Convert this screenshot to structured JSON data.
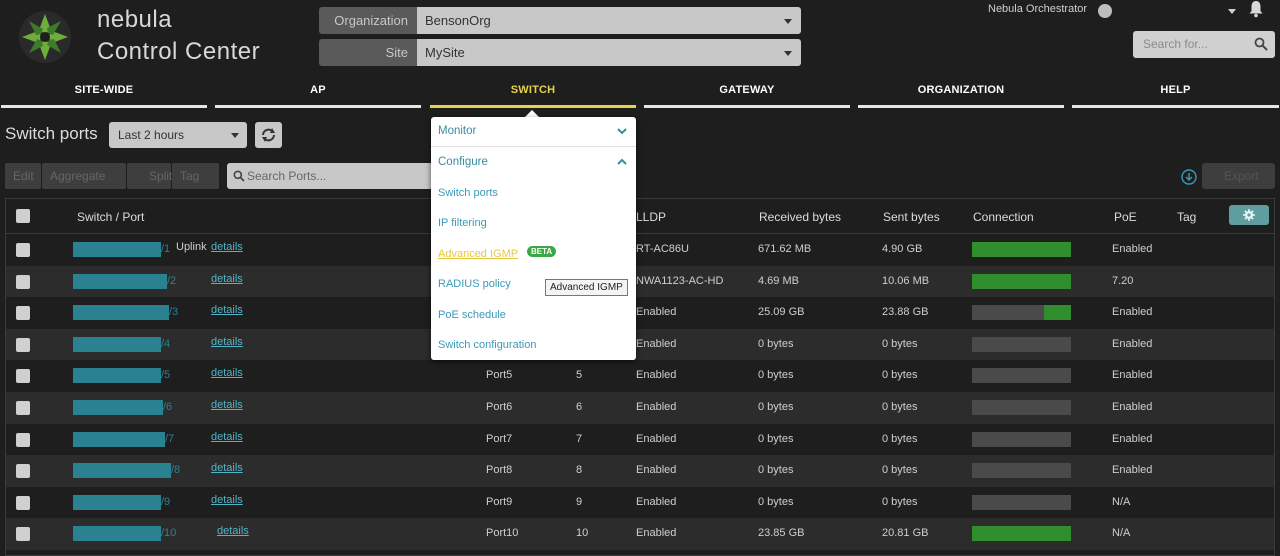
{
  "brand": {
    "line1": "nebula",
    "line2": "Control Center"
  },
  "org": {
    "label": "Organization",
    "value": "BensonOrg"
  },
  "site": {
    "label": "Site",
    "value": "MySite"
  },
  "user": {
    "name": "Nebula Orchestrator"
  },
  "search": {
    "placeholder": "Search for..."
  },
  "nav": [
    {
      "label": "SITE-WIDE"
    },
    {
      "label": "AP"
    },
    {
      "label": "SWITCH"
    },
    {
      "label": "GATEWAY"
    },
    {
      "label": "ORGANIZATION"
    },
    {
      "label": "HELP"
    }
  ],
  "page": {
    "title": "Switch ports",
    "time_range": "Last 2 hours"
  },
  "toolbar": {
    "edit": "Edit",
    "aggregate": "Aggregate",
    "split": "Split",
    "tag": "Tag",
    "search_placeholder": "Search Ports...",
    "export": "Export"
  },
  "table": {
    "headers": {
      "switch_port": "Switch / Port",
      "lldp": "LLDP",
      "received": "Received bytes",
      "sent": "Sent bytes",
      "connection": "Connection",
      "poe": "PoE",
      "tag": "Tag"
    },
    "details_label": "details",
    "rows": [
      {
        "idx": "/1",
        "uplink": "Uplink",
        "name": "",
        "num": "",
        "lldp": "RT-AC86U",
        "recv": "671.62 MB",
        "sent": "4.90 GB",
        "conn": 1.0,
        "poe": "Enabled"
      },
      {
        "idx": "/2",
        "uplink": "",
        "name": "",
        "num": "",
        "lldp": "NWA1123-AC-HD",
        "recv": "4.69 MB",
        "sent": "10.06 MB",
        "conn": 1.0,
        "poe": "7.20"
      },
      {
        "idx": "/3",
        "uplink": "",
        "name": "",
        "num": "",
        "lldp": "Enabled",
        "recv": "25.09 GB",
        "sent": "23.88 GB",
        "conn": 0.27,
        "poe": "Enabled"
      },
      {
        "idx": "/4",
        "uplink": "",
        "name": "",
        "num": "",
        "lldp": "Enabled",
        "recv": "0 bytes",
        "sent": "0 bytes",
        "conn": 0,
        "poe": "Enabled"
      },
      {
        "idx": "/5",
        "uplink": "",
        "name": "Port5",
        "num": "5",
        "lldp": "Enabled",
        "recv": "0 bytes",
        "sent": "0 bytes",
        "conn": 0,
        "poe": "Enabled"
      },
      {
        "idx": "/6",
        "uplink": "",
        "name": "Port6",
        "num": "6",
        "lldp": "Enabled",
        "recv": "0 bytes",
        "sent": "0 bytes",
        "conn": 0,
        "poe": "Enabled"
      },
      {
        "idx": "/7",
        "uplink": "",
        "name": "Port7",
        "num": "7",
        "lldp": "Enabled",
        "recv": "0 bytes",
        "sent": "0 bytes",
        "conn": 0,
        "poe": "Enabled"
      },
      {
        "idx": "/8",
        "uplink": "",
        "name": "Port8",
        "num": "8",
        "lldp": "Enabled",
        "recv": "0 bytes",
        "sent": "0 bytes",
        "conn": 0,
        "poe": "Enabled"
      },
      {
        "idx": "/9",
        "uplink": "",
        "name": "Port9",
        "num": "9",
        "lldp": "Enabled",
        "recv": "0 bytes",
        "sent": "0 bytes",
        "conn": 0,
        "poe": "N/A"
      },
      {
        "idx": "/10",
        "uplink": "",
        "name": "Port10",
        "num": "10",
        "lldp": "Enabled",
        "recv": "23.85 GB",
        "sent": "20.81 GB",
        "conn": 1.0,
        "poe": "N/A"
      }
    ]
  },
  "menu": {
    "monitor": "Monitor",
    "configure": "Configure",
    "items": [
      {
        "label": "Switch ports"
      },
      {
        "label": "IP filtering"
      },
      {
        "label": "Advanced IGMP"
      },
      {
        "label": "RADIUS policy"
      },
      {
        "label": "PoE schedule"
      },
      {
        "label": "Switch configuration"
      }
    ],
    "beta": "BETA",
    "tooltip": "Advanced IGMP"
  },
  "colors": {
    "accent": "#e8d24a",
    "teal": "#2a8290",
    "link": "#4fb5c8",
    "connection_up": "#2f8f2f"
  }
}
